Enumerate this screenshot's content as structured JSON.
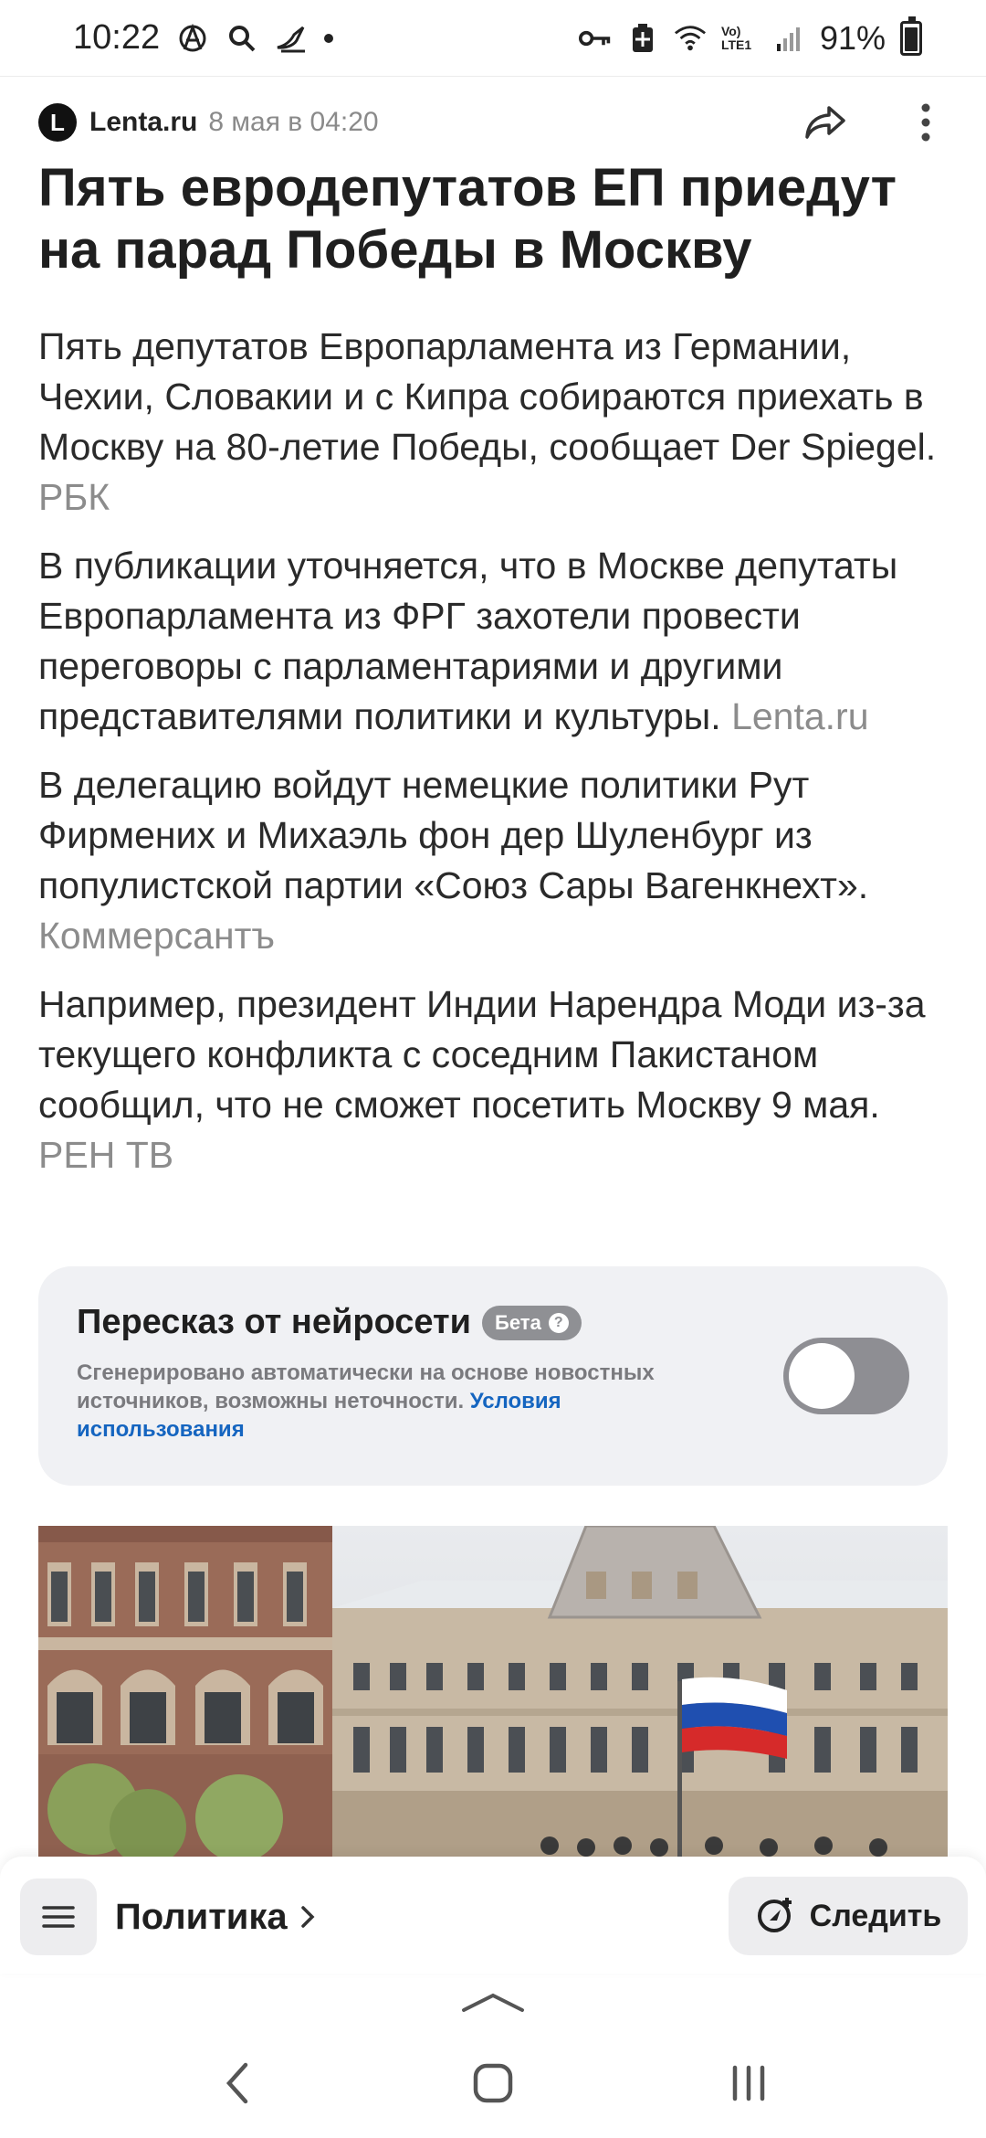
{
  "status_bar": {
    "time": "10:22",
    "left_icons": [
      "anarchy-icon",
      "search-icon",
      "bird-icon"
    ],
    "right_icons": [
      "key-icon",
      "battery-saver-icon",
      "wifi-icon",
      "lte-icon",
      "signal-icon"
    ],
    "battery_percent": "91%",
    "lte_label": "Vo) LTE1"
  },
  "article": {
    "source_logo_letter": "L",
    "source_name": "Lenta.ru",
    "date": "8 мая в 04:20",
    "headline": "Пять евродепутатов ЕП приедут на парад Победы в Москву",
    "paragraphs": [
      {
        "text": "Пять депутатов Европарламента из Германии, Чехии, Словакии и с Кипра собираются приехать в Москву на 80-летие Победы, сообщает Der Spiegel.",
        "source": "РБК"
      },
      {
        "text": "В публикации уточняется, что в Москве депутаты Европарламента из ФРГ захотели провести переговоры с парламентариями и другими представителями политики и культуры.",
        "source": "Lenta.ru"
      },
      {
        "text": "В делегацию войдут немецкие политики Рут Фирмених и Михаэль фон дер Шуленбург из популистской партии «Союз Сары Вагенкнехт».",
        "source": "Коммерсантъ"
      },
      {
        "text": "Например, президент Индии Нарендра Моди из-за текущего конфликта с соседним Пакистаном сообщил, что не сможет посетить Москву 9 мая.",
        "source": "РЕН ТВ"
      }
    ]
  },
  "ai_summary": {
    "title": "Пересказ от нейросети",
    "badge": "Бета",
    "badge_help": "?",
    "description": "Сгенерировано автоматически на основе новостных источников, возможны неточности.",
    "link": "Условия использования",
    "toggle_on": false
  },
  "bottom_bar": {
    "category": "Политика",
    "follow_label": "Следить"
  },
  "colors": {
    "source_text": "#8c8c8c",
    "link": "#1565c0",
    "card_bg": "#f0f1f4",
    "toggle_off": "#8e8e93"
  }
}
